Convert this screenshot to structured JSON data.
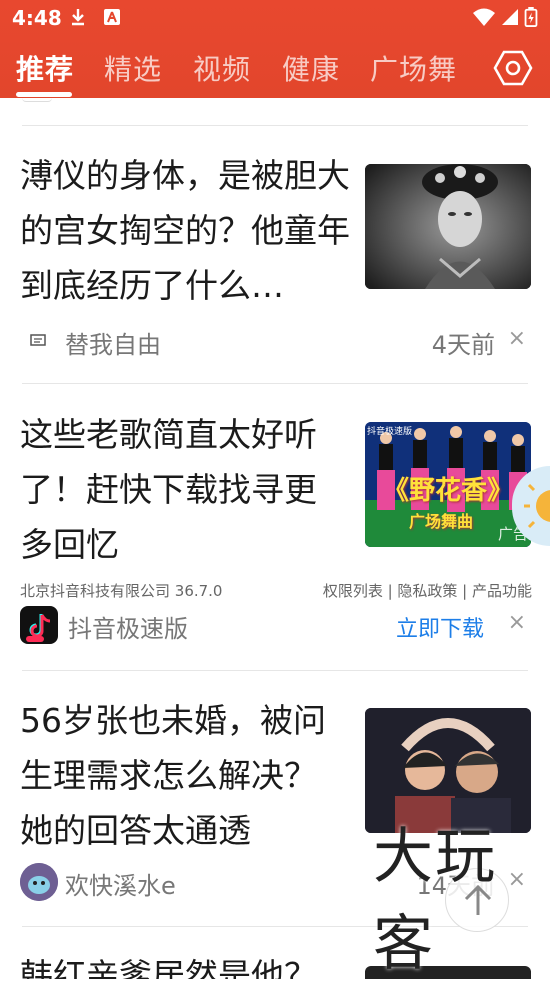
{
  "status": {
    "time": "4:48"
  },
  "tabs": [
    {
      "label": "推荐"
    },
    {
      "label": "精选"
    },
    {
      "label": "视频"
    },
    {
      "label": "健康"
    },
    {
      "label": "广场舞"
    }
  ],
  "articles": [
    {
      "title": "溥仪的身体，是被胆大的宫女掏空的？他童年到底经历了什么…",
      "source": "替我自由",
      "time": "4天前",
      "close": "×"
    },
    {
      "title": "这些老歌简直太好听了！赶快下载找寻更多回忆",
      "thumb_banner": "抖音极速版",
      "thumb_title": "《野花香》",
      "thumb_subtitle": "广场舞曲",
      "ad_label": "广告",
      "company": "北京抖音科技有限公司  36.7.0",
      "links": "权限列表 | 隐私政策 | 产品功能",
      "app_name": "抖音极速版",
      "download": "立即下载",
      "close": "×"
    },
    {
      "title": "56岁张也未婚，被问生理需求怎么解决？她的回答太通透",
      "source": "欢快溪水e",
      "time": "14天前",
      "close": "×"
    },
    {
      "title": "韩红亲爹居然是他？"
    }
  ],
  "watermark": "大玩客",
  "colors": {
    "brand": "#e5472d",
    "link": "#1d7ee8"
  }
}
